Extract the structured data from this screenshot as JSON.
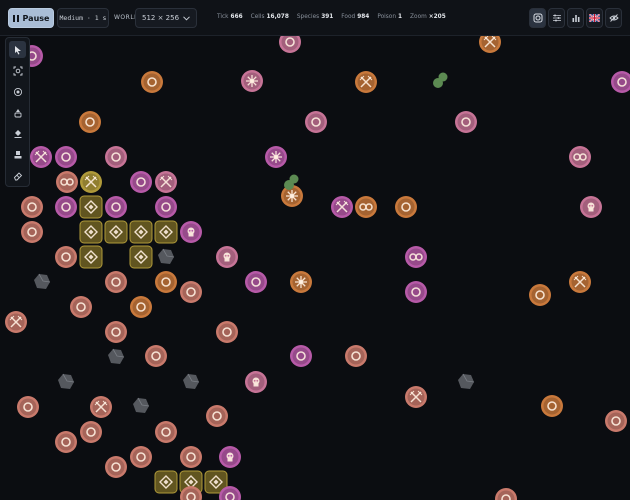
{
  "topbar": {
    "pause_label": "Pause",
    "speed_label": "Medium · 1 s",
    "world_label": "WORLD",
    "world_size": "512 × 256",
    "stats": [
      {
        "label": "Tick",
        "value": "666"
      },
      {
        "label": "Cells",
        "value": "16,078"
      },
      {
        "label": "Species",
        "value": "391"
      },
      {
        "label": "Food",
        "value": "984"
      },
      {
        "label": "Poison",
        "value": "1"
      },
      {
        "label": "Zoom",
        "value": "×205"
      }
    ],
    "right_buttons": [
      "snapshot-icon",
      "sliders-icon",
      "bar-chart-icon",
      "uk-flag-icon",
      "eye-icon"
    ]
  },
  "toolbar": {
    "tools": [
      "select-pointer-icon",
      "focus-target-icon",
      "spawn-cell-icon",
      "add-food-icon",
      "add-poison-icon",
      "stamp-icon",
      "eraser-icon"
    ],
    "active_tool": "select-pointer-icon"
  },
  "colors": {
    "background": "#0b0d11",
    "type_colors": {
      "salmon": "#c97a6c",
      "orange": "#c9793c",
      "magenta": "#b75aa8",
      "pink": "#c77497",
      "olive": "#b09a3a",
      "gray": "#55585e",
      "green": "#5c8a52"
    }
  },
  "cell_type_icons": {
    "o": "ring-icon",
    "x": "crossed-swords-icon",
    "k": "skull-icon",
    "8": "infinity-icon",
    "*": "burst-icon",
    "d": "diamond-icon",
    "r": "rock-icon",
    "g": "blob-icon"
  }
}
